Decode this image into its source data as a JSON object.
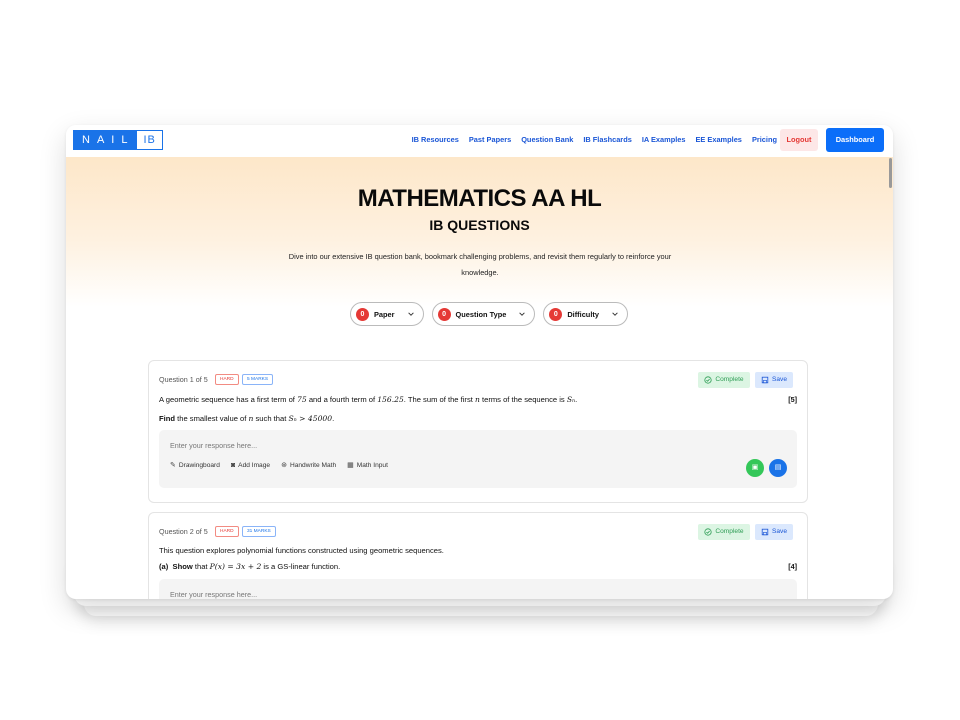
{
  "navbar": {
    "logo_main": "NAIL",
    "logo_ib": "IB",
    "links": [
      "IB Resources",
      "Past Papers",
      "Question Bank",
      "IB Flashcards",
      "IA Examples",
      "EE Examples",
      "Pricing"
    ],
    "logout_label": "Logout",
    "dashboard_label": "Dashboard"
  },
  "hero": {
    "title": "MATHEMATICS AA HL",
    "subtitle": "IB QUESTIONS",
    "description": "Dive into our extensive IB question bank, bookmark challenging problems, and revisit them regularly to reinforce your knowledge."
  },
  "filters": [
    {
      "count": "0",
      "label": "Paper"
    },
    {
      "count": "0",
      "label": "Question Type"
    },
    {
      "count": "0",
      "label": "Difficulty"
    }
  ],
  "questions": [
    {
      "label": "Question 1 of 5",
      "difficulty": "HARD",
      "marks_tag": "5 MARKS",
      "complete_label": "Complete",
      "save_label": "Save",
      "line1": {
        "t1": "A geometric sequence has a first term of ",
        "m1": "75",
        "t2": " and a fourth term of ",
        "m2": "156.25",
        "t3": ". The sum of the first ",
        "m3": "n",
        "t4": " terms of the sequence is ",
        "m4": "Sₙ",
        "t5": "."
      },
      "marks": "[5]",
      "line2": {
        "bold": "Find",
        "t1": " the smallest value of ",
        "m1": "n",
        "t2": " such that ",
        "m2": "Sₙ > 45000",
        "t3": "."
      },
      "placeholder": "Enter your response here...",
      "tools": [
        "Drawingboard",
        "Add Image",
        "Handwrite Math",
        "Math Input"
      ]
    },
    {
      "label": "Question 2 of 5",
      "difficulty": "HARD",
      "marks_tag": "31 MARKS",
      "complete_label": "Complete",
      "save_label": "Save",
      "intro": "This question explores polynomial functions constructed using geometric sequences.",
      "part": {
        "label": "(a)",
        "bold": "Show",
        "t1": " that ",
        "m1": "P(x) = 3x + 2",
        "t2": " is a GS-linear function."
      },
      "marks": "[4]",
      "placeholder": "Enter your response here..."
    }
  ],
  "colors": {
    "brand_blue": "#1a73e8",
    "danger_red": "#e53935",
    "success_green": "#34c759"
  }
}
